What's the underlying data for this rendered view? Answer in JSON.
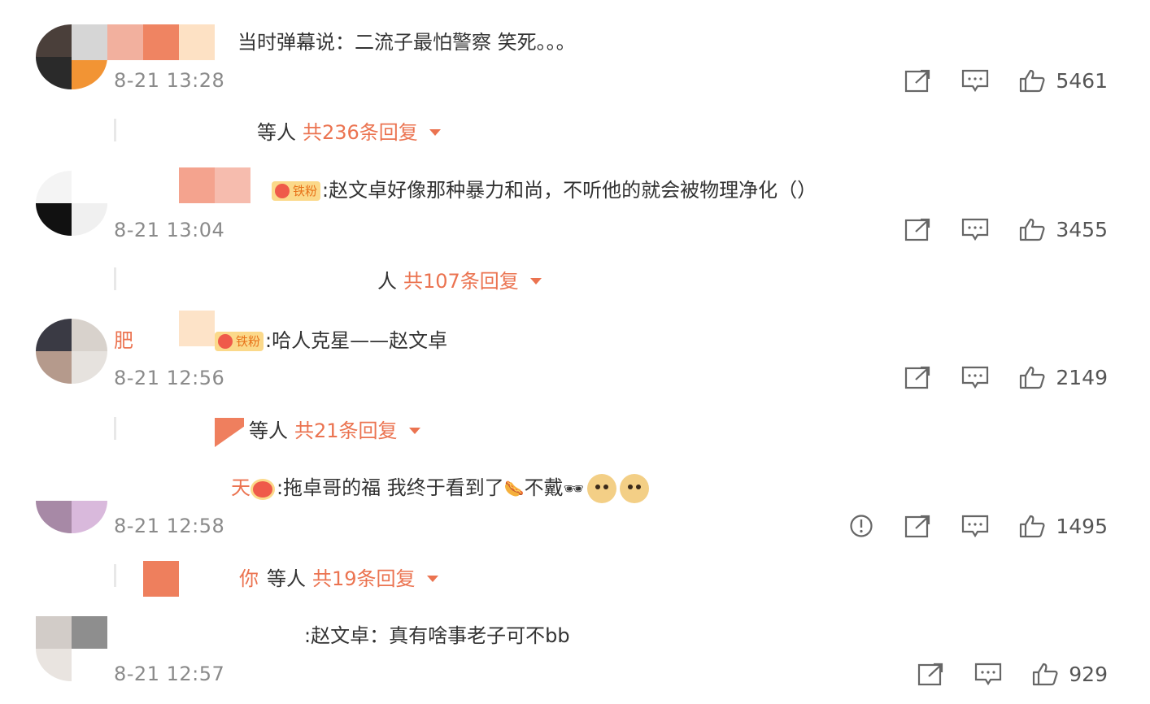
{
  "comments": [
    {
      "text": "当时弹幕说：二流子最怕警察 笑死。。。",
      "time": "8-21 13:28",
      "likes": "5461",
      "badge": "",
      "replies": {
        "prefix": "等人",
        "link": "共236条回复"
      }
    },
    {
      "text": ":赵文卓好像那种暴力和尚，不听他的就会被物理净化（）",
      "time": "8-21 13:04",
      "likes": "3455",
      "badge": "铁粉",
      "badge_level": "3",
      "replies": {
        "prefix": "人",
        "link": "共107条回复"
      }
    },
    {
      "text": ":哈人克星——赵文卓",
      "time": "8-21 12:56",
      "likes": "2149",
      "badge": "铁粉",
      "name_fragment": "肥",
      "replies": {
        "prefix": "等人",
        "link": "共21条回复"
      }
    },
    {
      "text": ":拖卓哥的福 我终于看到了",
      "text_tail": "不戴",
      "time": "8-21 12:58",
      "likes": "1495",
      "name_fragment": "天",
      "replies": {
        "prefix_name": "你",
        "prefix": "等人",
        "link": "共19条回复"
      }
    },
    {
      "text": ":赵文卓：真有啥事老子可不bb",
      "time": "8-21 12:57",
      "likes": "929"
    }
  ],
  "icons": {
    "share": "share-icon",
    "comment": "comment-icon",
    "like": "like-icon",
    "report": "report-icon",
    "expand": "chevron-down-icon"
  },
  "colors": {
    "accent": "#eb7350",
    "time": "#8a8a8a",
    "text": "#333333",
    "badge_bg": "#fbd98a"
  }
}
